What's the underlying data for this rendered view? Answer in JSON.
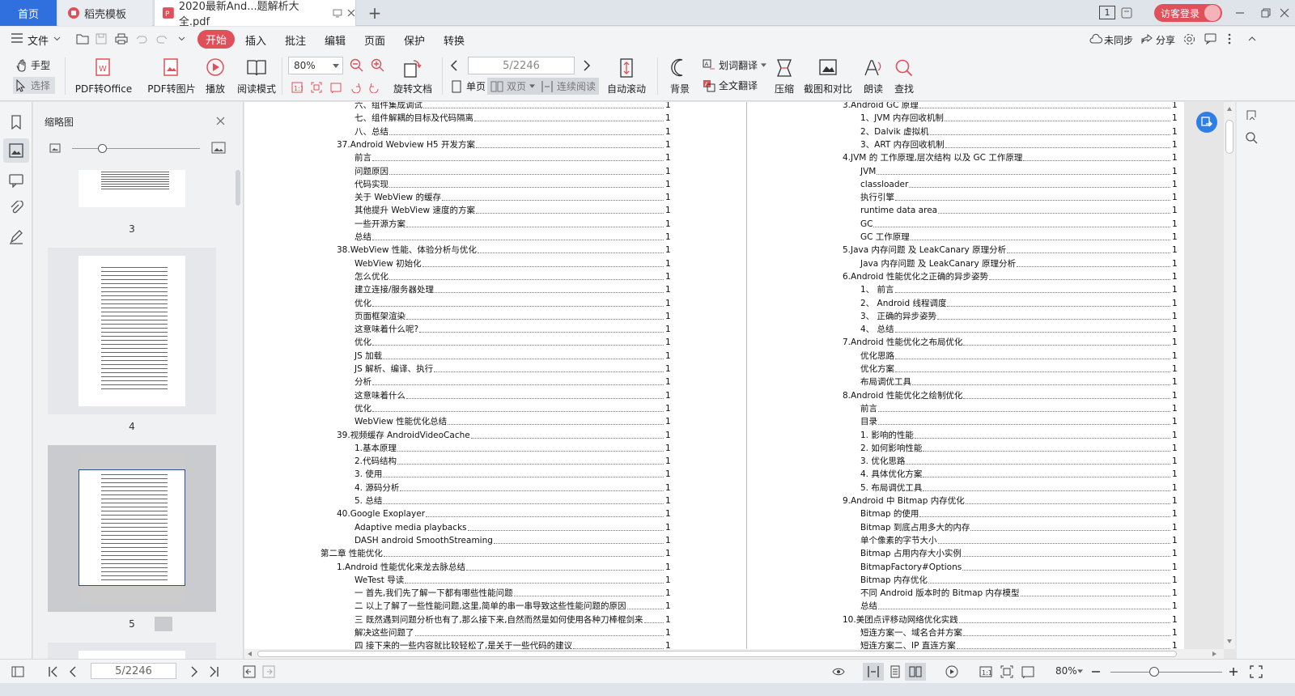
{
  "tabs": {
    "home": "首页",
    "daoke": "稻壳模板",
    "pdf": "2020最新And...题解析大全.pdf",
    "add": "+"
  },
  "titlebar": {
    "page_badge": "1",
    "login": "访客登录"
  },
  "menu": {
    "file": "文件",
    "start": "开始",
    "insert": "插入",
    "annotate": "批注",
    "edit": "编辑",
    "page": "页面",
    "protect": "保护",
    "convert": "转换",
    "unsync": "未同步",
    "share": "分享"
  },
  "toolbar": {
    "hand": "手型",
    "select": "选择",
    "pdf_office": "PDF转Office",
    "pdf_image": "PDF转图片",
    "play": "播放",
    "read_mode": "阅读模式",
    "zoom": "80%",
    "page_value": "5/2246",
    "rotate": "旋转文档",
    "single": "单页",
    "double": "双页",
    "continuous": "连续阅读",
    "autoscroll": "自动滚动",
    "background": "背景",
    "word_translate": "划词翻译",
    "full_translate": "全文翻译",
    "compress": "压缩",
    "screenshot": "截图和对比",
    "read_aloud": "朗读",
    "find": "查找"
  },
  "thumbnails": {
    "title": "缩略图",
    "pages": [
      "3",
      "4",
      "5"
    ]
  },
  "left_page": [
    {
      "t": "六、组件集成调试",
      "p": "1",
      "lvl": 2
    },
    {
      "t": "七、组件解耦的目标及代码隔离",
      "p": "1",
      "lvl": 2
    },
    {
      "t": "八、总结",
      "p": "1",
      "lvl": 2
    },
    {
      "t": "37.Android Webview H5 开发方案",
      "p": "1",
      "lvl": 1
    },
    {
      "t": "前言",
      "p": "1",
      "lvl": 2
    },
    {
      "t": "问题原因",
      "p": "1",
      "lvl": 2
    },
    {
      "t": "代码实现",
      "p": "1",
      "lvl": 2
    },
    {
      "t": "关于 WebView 的缓存",
      "p": "1",
      "lvl": 2
    },
    {
      "t": "其他提升 WebView 速度的方案",
      "p": "1",
      "lvl": 2
    },
    {
      "t": "一些开源方案",
      "p": "1",
      "lvl": 2
    },
    {
      "t": "总结",
      "p": "1",
      "lvl": 2
    },
    {
      "t": "38.WebView 性能、体验分析与优化",
      "p": "1",
      "lvl": 1
    },
    {
      "t": "WebView 初始化",
      "p": "1",
      "lvl": 2
    },
    {
      "t": "怎么优化",
      "p": "1",
      "lvl": 2
    },
    {
      "t": "建立连接/服务器处理",
      "p": "1",
      "lvl": 2
    },
    {
      "t": "优化",
      "p": "1",
      "lvl": 2
    },
    {
      "t": "页面框架渲染",
      "p": "1",
      "lvl": 2
    },
    {
      "t": "这意味着什么呢?",
      "p": "1",
      "lvl": 2
    },
    {
      "t": "优化",
      "p": "1",
      "lvl": 2
    },
    {
      "t": "JS 加载",
      "p": "1",
      "lvl": 2
    },
    {
      "t": "JS 解析、编译、执行",
      "p": "1",
      "lvl": 2
    },
    {
      "t": "分析",
      "p": "1",
      "lvl": 2
    },
    {
      "t": "这意味着什么",
      "p": "1",
      "lvl": 2
    },
    {
      "t": "优化",
      "p": "1",
      "lvl": 2
    },
    {
      "t": "WebView 性能优化总结",
      "p": "1",
      "lvl": 2
    },
    {
      "t": "39.视频缓存 AndroidVideoCache",
      "p": "1",
      "lvl": 1
    },
    {
      "t": "1.基本原理",
      "p": "1",
      "lvl": 2
    },
    {
      "t": "2.代码结构",
      "p": "1",
      "lvl": 2
    },
    {
      "t": "3. 使用",
      "p": "1",
      "lvl": 2
    },
    {
      "t": "4. 源码分析",
      "p": "1",
      "lvl": 2
    },
    {
      "t": "5. 总结",
      "p": "1",
      "lvl": 2
    },
    {
      "t": "40.Google Exoplayer",
      "p": "1",
      "lvl": 1
    },
    {
      "t": "Adaptive media playbacks",
      "p": "1",
      "lvl": 2
    },
    {
      "t": "DASH android SmoothStreaming",
      "p": "1",
      "lvl": 2
    },
    {
      "t": "第二章 性能优化",
      "p": "1",
      "lvl": 0
    },
    {
      "t": "1.Android 性能优化来龙去脉总结",
      "p": "1",
      "lvl": 1
    },
    {
      "t": "WeTest 导读",
      "p": "1",
      "lvl": 2
    },
    {
      "t": "一 首先,我们先了解一下都有哪些性能问题",
      "p": "1",
      "lvl": 2
    },
    {
      "t": "二 以上了解了一些性能问题,这里,简单的串一串导致这些性能问题的原因",
      "p": "1",
      "lvl": 2
    },
    {
      "t": "三 既然遇到问题分析也有了,那么接下来,自然而然是如何使用各种刀棒棍剑来",
      "p": "1",
      "lvl": 2
    },
    {
      "t": "解决这些问题了",
      "p": "1",
      "lvl": 2
    },
    {
      "t": "四 接下来的一些内容就比较轻松了,是关于一些代码的建议",
      "p": "1",
      "lvl": 2
    }
  ],
  "right_page": [
    {
      "t": "3.Android GC 原理",
      "p": "1",
      "lvl": 1
    },
    {
      "t": "1、JVM 内存回收机制",
      "p": "1",
      "lvl": 2
    },
    {
      "t": "2、Dalvik 虚拟机",
      "p": "1",
      "lvl": 2
    },
    {
      "t": "3、ART 内存回收机制",
      "p": "1",
      "lvl": 2
    },
    {
      "t": "4.JVM 的 工作原理,层次结构 以及 GC 工作原理",
      "p": "1",
      "lvl": 1
    },
    {
      "t": "JVM",
      "p": "1",
      "lvl": 2
    },
    {
      "t": "classloader",
      "p": "1",
      "lvl": 2
    },
    {
      "t": "执行引擎",
      "p": "1",
      "lvl": 2
    },
    {
      "t": "runtime data area",
      "p": "1",
      "lvl": 2
    },
    {
      "t": "GC",
      "p": "1",
      "lvl": 2
    },
    {
      "t": "GC 工作原理",
      "p": "1",
      "lvl": 2
    },
    {
      "t": "5.Java 内存问题 及 LeakCanary 原理分析",
      "p": "1",
      "lvl": 1
    },
    {
      "t": "Java 内存问题 及 LeakCanary 原理分析",
      "p": "1",
      "lvl": 2
    },
    {
      "t": "6.Android 性能优化之正确的异步姿势",
      "p": "1",
      "lvl": 1
    },
    {
      "t": "1、 前言",
      "p": "1",
      "lvl": 2
    },
    {
      "t": "2、 Android 线程调度",
      "p": "1",
      "lvl": 2
    },
    {
      "t": "3、 正确的异步姿势",
      "p": "1",
      "lvl": 2
    },
    {
      "t": "4、 总结",
      "p": "1",
      "lvl": 2
    },
    {
      "t": "7.Android 性能优化之布局优化",
      "p": "1",
      "lvl": 1
    },
    {
      "t": "优化思路",
      "p": "1",
      "lvl": 2
    },
    {
      "t": "优化方案",
      "p": "1",
      "lvl": 2
    },
    {
      "t": "布局调优工具",
      "p": "1",
      "lvl": 2
    },
    {
      "t": "8.Android 性能优化之绘制优化",
      "p": "1",
      "lvl": 1
    },
    {
      "t": "前言",
      "p": "1",
      "lvl": 2
    },
    {
      "t": "目录",
      "p": "1",
      "lvl": 2
    },
    {
      "t": "1. 影响的性能",
      "p": "1",
      "lvl": 2
    },
    {
      "t": "2. 如何影响性能",
      "p": "1",
      "lvl": 2
    },
    {
      "t": "3. 优化思路",
      "p": "1",
      "lvl": 2
    },
    {
      "t": "4. 具体优化方案",
      "p": "1",
      "lvl": 2
    },
    {
      "t": "5. 布局调优工具",
      "p": "1",
      "lvl": 2
    },
    {
      "t": "9.Android 中 Bitmap 内存优化",
      "p": "1",
      "lvl": 1
    },
    {
      "t": "Bitmap 的使用",
      "p": "1",
      "lvl": 2
    },
    {
      "t": "Bitmap 到底占用多大的内存",
      "p": "1",
      "lvl": 2
    },
    {
      "t": "单个像素的字节大小",
      "p": "1",
      "lvl": 2
    },
    {
      "t": "Bitmap 占用内存大小实例",
      "p": "1",
      "lvl": 2
    },
    {
      "t": "BitmapFactory#Options",
      "p": "1",
      "lvl": 2
    },
    {
      "t": "Bitmap 内存优化",
      "p": "1",
      "lvl": 2
    },
    {
      "t": "不同 Android 版本时的 Bitmap 内存模型",
      "p": "1",
      "lvl": 2
    },
    {
      "t": "总结",
      "p": "1",
      "lvl": 2
    },
    {
      "t": "10.美团点评移动网络优化实践",
      "p": "1",
      "lvl": 1
    },
    {
      "t": "短连方案一、域名合并方案",
      "p": "1",
      "lvl": 2
    },
    {
      "t": "短连方案二、IP 直连方案",
      "p": "1",
      "lvl": 2
    }
  ],
  "statusbar": {
    "page_value": "5/2246",
    "zoom": "80%"
  },
  "colors": {
    "accent": "#e0505a",
    "home_tab": "#2f6fde",
    "pdf_icon": "#e0505a"
  }
}
